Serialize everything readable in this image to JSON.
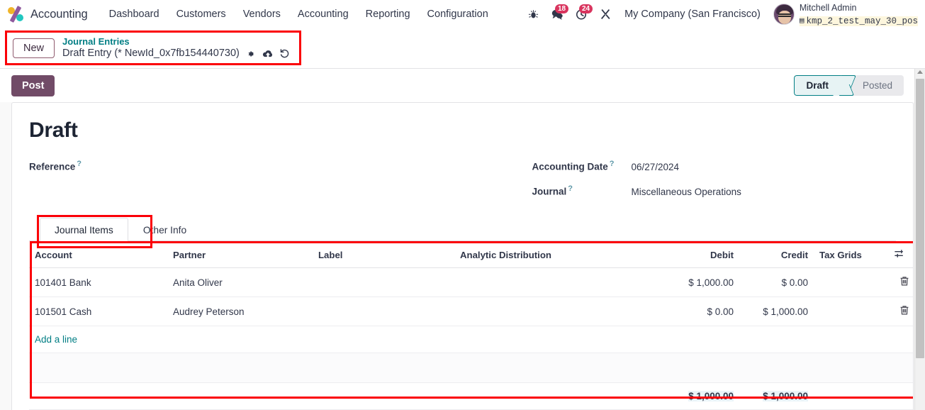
{
  "navbar": {
    "brand": "Accounting",
    "logo_icon": "odoo-logo-icon",
    "menu": [
      {
        "label": "Dashboard"
      },
      {
        "label": "Customers"
      },
      {
        "label": "Vendors"
      },
      {
        "label": "Accounting"
      },
      {
        "label": "Reporting"
      },
      {
        "label": "Configuration"
      }
    ],
    "systray": {
      "bug_icon": "bug-icon",
      "messages_icon": "chat-bubble-icon",
      "messages_count": "18",
      "activities_icon": "clock-icon",
      "activities_count": "24",
      "tools_icon": "crossed-tools-icon",
      "company": "My Company (San Francisco)",
      "user_name": "Mitchell Admin",
      "database": "kmp_2_test_may_30_pos",
      "database_icon": "database-icon",
      "avatar": "user-avatar"
    }
  },
  "control_panel": {
    "new_button": "New",
    "breadcrumb_parent": "Journal Entries",
    "breadcrumb_current": "Draft Entry (* NewId_0x7fb154440730)",
    "gear_icon": "gear-icon",
    "save_icon": "cloud-upload-icon",
    "discard_icon": "discard-undo-icon"
  },
  "statusbar": {
    "post_button": "Post",
    "stages": [
      {
        "label": "Draft",
        "active": true
      },
      {
        "label": "Posted",
        "active": false
      }
    ]
  },
  "form": {
    "title": "Draft",
    "reference_label": "Reference",
    "reference_value": "",
    "accounting_date_label": "Accounting Date",
    "accounting_date_value": "06/27/2024",
    "journal_label": "Journal",
    "journal_value": "Miscellaneous Operations",
    "help_marker": "?"
  },
  "notebook": {
    "tabs": [
      {
        "label": "Journal Items",
        "active": true
      },
      {
        "label": "Other Info",
        "active": false
      }
    ]
  },
  "journal_items": {
    "columns": [
      "Account",
      "Partner",
      "Label",
      "Analytic Distribution",
      "Debit",
      "Credit",
      "Tax Grids"
    ],
    "optional_columns_icon": "column-options-icon",
    "rows": [
      {
        "account": "101401 Bank",
        "partner": "Anita Oliver",
        "label": "",
        "analytic": "",
        "debit": "$ 1,000.00",
        "credit": "$ 0.00",
        "tax_grids": "",
        "delete_icon": "trash-icon"
      },
      {
        "account": "101501 Cash",
        "partner": "Audrey Peterson",
        "label": "",
        "analytic": "",
        "debit": "$ 0.00",
        "credit": "$ 1,000.00",
        "tax_grids": "",
        "delete_icon": "trash-icon"
      }
    ],
    "add_line": "Add a line",
    "totals": {
      "debit": "$ 1,000.00",
      "credit": "$ 1,000.00"
    }
  },
  "highlights": {
    "color": "#fb0007",
    "regions": [
      "breadcrumb-area",
      "journal-items-tab",
      "journal-items-table"
    ]
  },
  "colors": {
    "brand_purple": "#714b67",
    "link_teal": "#017e84",
    "badge_red": "#d9345e",
    "highlight_red": "#fb0007"
  }
}
